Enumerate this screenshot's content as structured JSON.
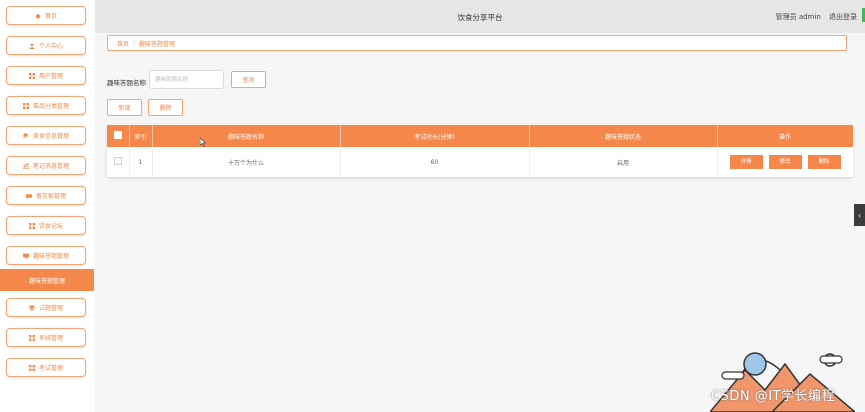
{
  "header": {
    "title": "饮食分享平台",
    "admin_text": "管理员 admin",
    "logout": "退出登录"
  },
  "sidebar": {
    "items": [
      {
        "label": "首页",
        "icon": "home-icon"
      },
      {
        "label": "个人中心",
        "icon": "user-icon"
      },
      {
        "label": "用户管理",
        "icon": "grid-icon"
      },
      {
        "label": "菜品分类管理",
        "icon": "grid-icon"
      },
      {
        "label": "美食信息管理",
        "icon": "flag-icon"
      },
      {
        "label": "笔记消息管理",
        "icon": "sliders-icon"
      },
      {
        "label": "留言板管理",
        "icon": "chat-icon"
      },
      {
        "label": "饮食论坛",
        "icon": "grid-icon"
      },
      {
        "label": "趣味答题管理",
        "icon": "chat-icon"
      },
      {
        "label": "趣味答题管理",
        "icon": "none"
      },
      {
        "label": "试题管理",
        "icon": "pen-icon"
      },
      {
        "label": "系统管理",
        "icon": "grid-icon"
      },
      {
        "label": "考试管理",
        "icon": "grid-icon"
      }
    ]
  },
  "breadcrumb": {
    "home": "首页",
    "sep": "/",
    "current": "趣味答题管理"
  },
  "search": {
    "label": "趣味答题名称",
    "placeholder": "趣味答题名称",
    "button": "查询"
  },
  "toolbar": {
    "add": "新增",
    "delete": "删除"
  },
  "table": {
    "headers": [
      "",
      "索引",
      "趣味答题名称",
      "考试时长(分钟)",
      "趣味答题状态",
      "操作"
    ],
    "rows": [
      {
        "index": "1",
        "name": "十万个为什么",
        "duration": "60",
        "status": "启用",
        "actions": [
          "详情",
          "修改",
          "删除"
        ]
      }
    ]
  },
  "watermark": "CSDN @IT学长编程"
}
